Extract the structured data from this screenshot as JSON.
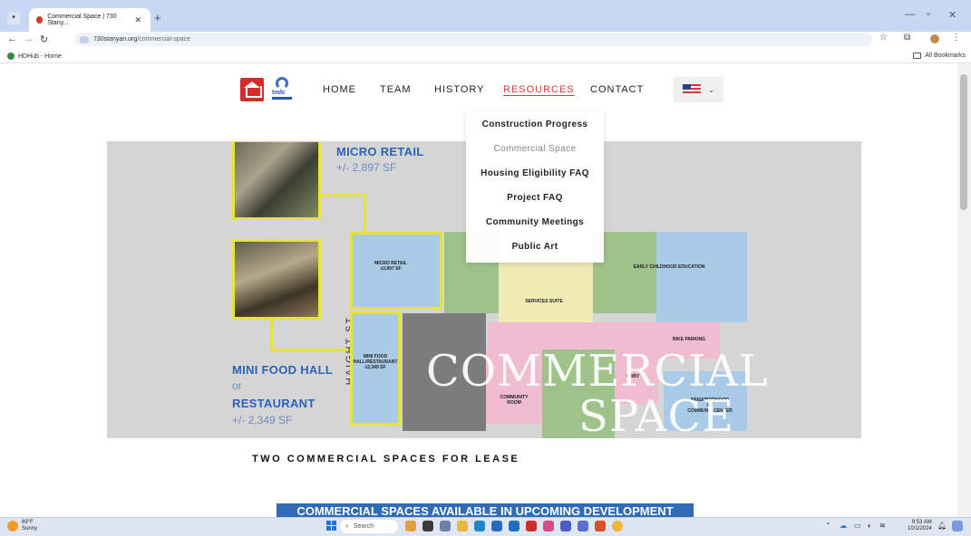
{
  "browser": {
    "tab_title": "Commercial Space | 730 Stany...",
    "tab_close": "✕",
    "new_tab": "+",
    "url_host": "730stanyan.org",
    "url_path": "/commercial-space",
    "bookmark": "HDHub - Home",
    "all_bookmarks": "All Bookmarks"
  },
  "nav": {
    "items": [
      "HOME",
      "TEAM",
      "HISTORY",
      "RESOURCES",
      "CONTACT"
    ],
    "active": "RESOURCES",
    "language_flag": "us-flag-icon"
  },
  "dropdown": {
    "items": [
      "Construction Progress",
      "Commercial Space",
      "Housing Eligibility FAQ",
      "Project FAQ",
      "Community Meetings",
      "Public Art"
    ],
    "current": "Commercial Space"
  },
  "hero": {
    "micro_retail_title": "MICRO RETAIL",
    "micro_retail_size": "+/- 2,897 SF",
    "food_hall_title": "MINI FOOD HALL",
    "or_text": "or",
    "restaurant_title": "RESTAURANT",
    "food_hall_size": "+/- 2,349 SF",
    "street_label": "HAIGHT ST",
    "plan_labels": {
      "micro_retail": "MICRO RETAIL\n±2,897 SF",
      "food_hall": "MINI FOOD\nHALL/RESTAURANT\n±2,349 SF",
      "services_suite": "SERVICES SUITE",
      "early_childhood": "EARLY CHILDHOOD EDUCATION",
      "bike_parking": "BIKE PARKING",
      "community_room": "COMMUNITY\nROOM",
      "lobby": "OBBY",
      "neighborhood_center": "NEIGHBORHOOD\nSE\nCOMMUN Y CENTER"
    },
    "watermark_line1": "COMMERCIAL",
    "watermark_line2": "SPACE"
  },
  "section_title": "TWO COMMERCIAL SPACES FOR LEASE",
  "banner": "COMMERCIAL SPACES AVAILABLE IN UPCOMING DEVELOPMENT",
  "taskbar": {
    "temperature": "69°F",
    "condition": "Sunny",
    "search_placeholder": "Search",
    "time": "9:53 AM",
    "date": "10/1/2024"
  },
  "colors": {
    "accent_red": "#d73c3c",
    "hero_blue": "#2b63b8",
    "highlight_yellow": "#e8e23c",
    "banner_blue": "#2f6cb5"
  }
}
